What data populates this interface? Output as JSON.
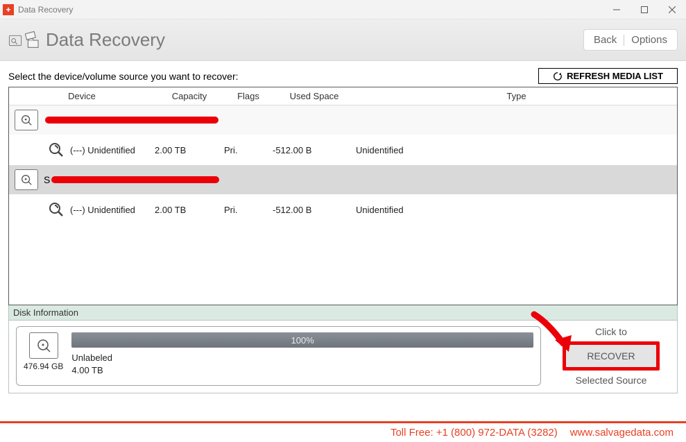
{
  "window_title": "Data Recovery",
  "header_title": "Data Recovery",
  "header": {
    "back": "Back",
    "options": "Options"
  },
  "source_prompt": "Select the device/volume source you want to recover:",
  "refresh_label": "REFRESH MEDIA LIST",
  "columns": {
    "device": "Device",
    "capacity": "Capacity",
    "flags": "Flags",
    "used": "Used Space",
    "type": "Type"
  },
  "devices": [
    {
      "label_prefix": "",
      "volumes": [
        {
          "name": "(---) Unidentified",
          "capacity": "2.00 TB",
          "flags": "Pri.",
          "used": "-512.00 B",
          "type": "Unidentified"
        }
      ]
    },
    {
      "label_prefix": "S",
      "volumes": [
        {
          "name": "(---) Unidentified",
          "capacity": "2.00 TB",
          "flags": "Pri.",
          "used": "-512.00 B",
          "type": "Unidentified"
        }
      ]
    }
  ],
  "disk_info": {
    "heading": "Disk Information",
    "percent_text": "100%",
    "vol_label": "Unlabeled",
    "vol_size": "4.00 TB",
    "total_size": "476.94 GB"
  },
  "recover": {
    "click_to": "Click to",
    "button": "RECOVER",
    "selected": "Selected Source"
  },
  "footer": {
    "toll": "Toll Free: +1 (800) 972-DATA (3282)",
    "site": "www.salvagedata.com"
  }
}
